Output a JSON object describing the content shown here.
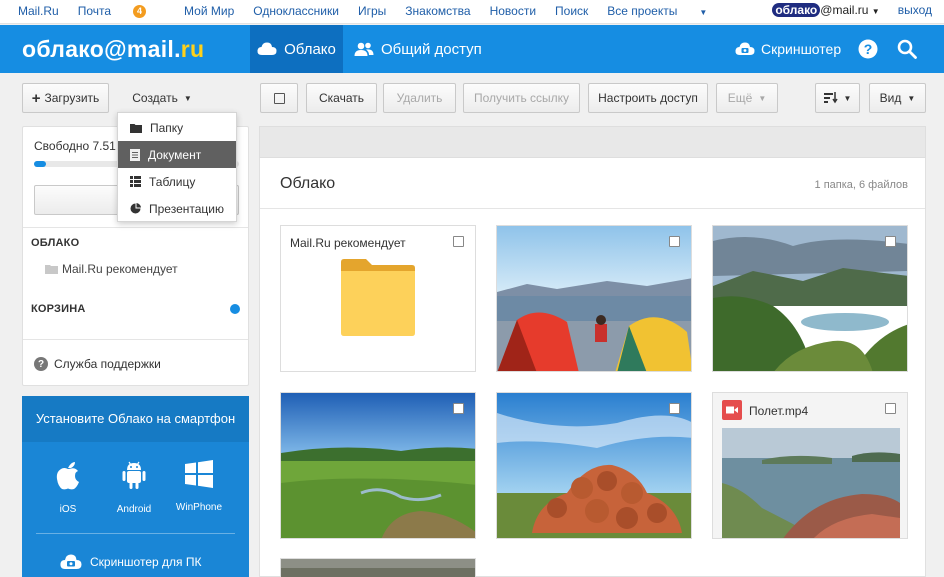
{
  "portal": {
    "links": [
      {
        "label": "Mail.Ru"
      },
      {
        "label": "Почта",
        "badge": "4"
      },
      {
        "label": "Мой Мир"
      },
      {
        "label": "Одноклассники"
      },
      {
        "label": "Игры"
      },
      {
        "label": "Знакомства"
      },
      {
        "label": "Новости"
      },
      {
        "label": "Поиск"
      },
      {
        "label": "Все проекты"
      }
    ],
    "user_name": "облако",
    "user_domain": "@mail.ru",
    "logout": "выход"
  },
  "header": {
    "logo_main": "облако@mail.",
    "logo_ru": "ru",
    "tab_cloud": "Облако",
    "tab_shared": "Общий доступ",
    "screenshoter": "Скриншотер",
    "help_icon": "help-icon",
    "search_icon": "search-icon"
  },
  "toolbar": {
    "upload": "Загрузить",
    "create": "Создать",
    "download": "Скачать",
    "delete": "Удалить",
    "get_link": "Получить ссылку",
    "setup_access": "Настроить доступ",
    "more": "Ещё",
    "view": "Вид"
  },
  "create_menu": {
    "items": [
      "Папку",
      "Документ",
      "Таблицу",
      "Презентацию"
    ],
    "highlighted": "Документ"
  },
  "sidebar": {
    "free_space": "Свободно 7.51",
    "usage_percent": 6,
    "connect_button": "Подкл",
    "cloud_heading": "ОБЛАКО",
    "folder": "Mail.Ru рекомендует",
    "trash_heading": "КОРЗИНА",
    "support": "Служба поддержки"
  },
  "promo": {
    "heading": "Установите Облако на смартфон",
    "ios": "iOS",
    "android": "Android",
    "winphone": "WinPhone",
    "footer": "Скриншотер для ПК"
  },
  "main": {
    "title": "Облако",
    "count": "1 папка, 6 файлов",
    "folder_name": "Mail.Ru рекомендует",
    "video_name": "Полет.mp4"
  },
  "colors": {
    "brand_blue": "#168de2",
    "active_tab": "#0d6fc0",
    "logo_accent": "#ffd11a",
    "folder_yellow": "#fdd15a"
  }
}
